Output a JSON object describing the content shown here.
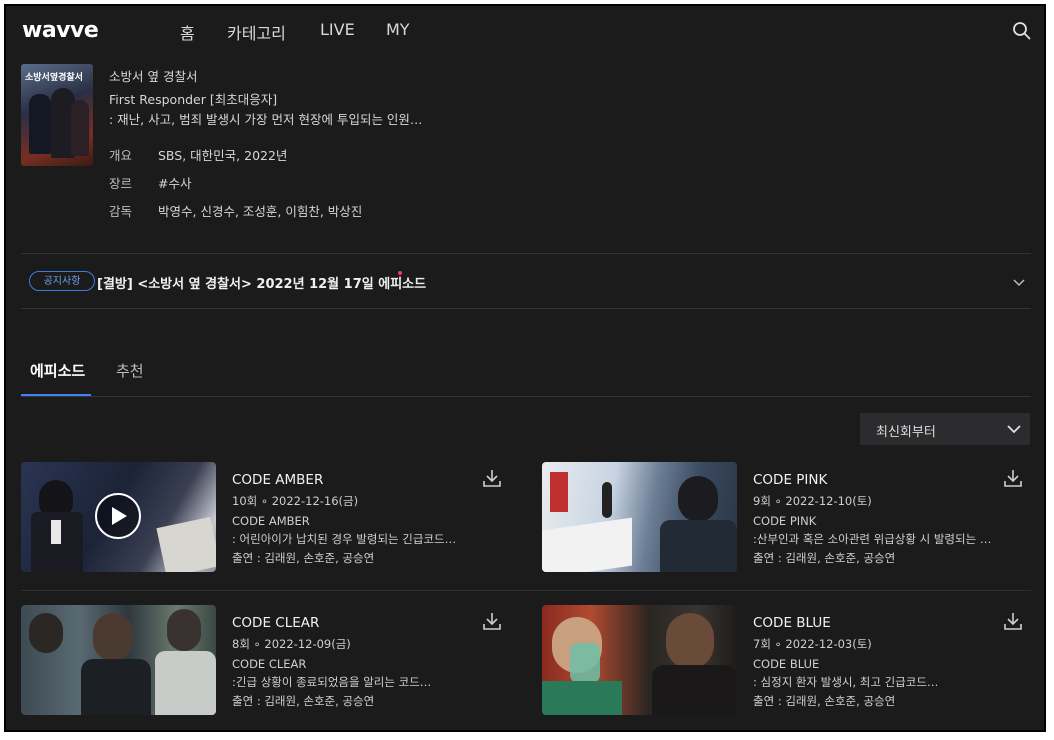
{
  "header": {
    "logo": "wavve",
    "nav": [
      "홈",
      "카테고리",
      "LIVE",
      "MY"
    ]
  },
  "program": {
    "title": "소방서 옆 경찰서",
    "subtitle": "First Responder [최초대응자]",
    "description": ": 재난, 사고, 범죄 발생시 가장 먼저 현장에 투입되는 인원…",
    "poster_text": "소방서옆경찰서",
    "meta": [
      {
        "label": "개요",
        "value": "SBS, 대한민국, 2022년"
      },
      {
        "label": "장르",
        "value": "#수사"
      },
      {
        "label": "감독",
        "value": "박영수, 신경수, 조성훈, 이힘찬, 박상진"
      }
    ]
  },
  "notice": {
    "badge": "공지사항",
    "text": "[결방] <소방서 옆 경찰서> 2022년 12월 17일 에피소드"
  },
  "tabs": [
    "에피소드",
    "추천"
  ],
  "sort": {
    "selected": "최신회부터"
  },
  "episodes": [
    {
      "title": "CODE AMBER",
      "meta": "10회 ∘ 2022-12-16(금)",
      "desc1": "CODE AMBER",
      "desc2": ": 어린아이가 납치된 경우 발령되는 긴급코드…",
      "cast": "출연 : 김래원, 손호준, 공승연"
    },
    {
      "title": "CODE PINK",
      "meta": "9회 ∘ 2022-12-10(토)",
      "desc1": "CODE PINK",
      "desc2": ":산부인과 혹은 소아관련 위급상황 시 발령되는 …",
      "cast": "출연 : 김래원, 손호준, 공승연"
    },
    {
      "title": "CODE CLEAR",
      "meta": "8회 ∘ 2022-12-09(금)",
      "desc1": "CODE CLEAR",
      "desc2": ":긴급 상황이 종료되었음을 알리는 코드…",
      "cast": "출연 : 김래원, 손호준, 공승연"
    },
    {
      "title": "CODE BLUE",
      "meta": "7회 ∘ 2022-12-03(토)",
      "desc1": "CODE BLUE",
      "desc2": ": 심정지 환자 발생시, 최고 긴급코드…",
      "cast": "출연 : 김래원, 손호준, 공승연"
    }
  ],
  "colors": {
    "background": "#1b1b1c",
    "accent": "#3b82f6",
    "notice_dot": "#ff2b8a"
  }
}
